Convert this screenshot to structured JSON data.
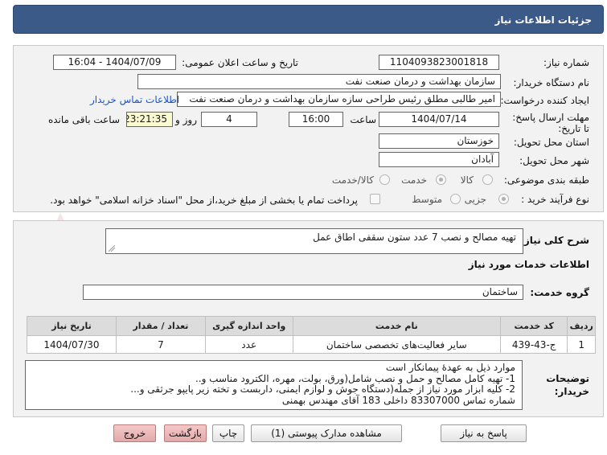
{
  "header": {
    "title": "جزئیات اطلاعات نیاز"
  },
  "fields": {
    "need_number_label": "شماره نیاز:",
    "need_number": "1104093823001818",
    "announce_label": "تاریخ و ساعت اعلان عمومی:",
    "announce_value": "1404/07/09 - 16:04",
    "buyer_org_label": "نام دستگاه خریدار:",
    "buyer_org": "سازمان بهداشت و درمان صنعت نفت",
    "creator_label": "ایجاد کننده درخواست:",
    "creator": "امیر طالبی مطلق رئیس طراحی سازه سازمان بهداشت و درمان صنعت نفت",
    "contact_link": "اطلاعات تماس خریدار",
    "deadline_label": "مهلت ارسال پاسخ: تا تاریخ:",
    "deadline_date": "1404/07/14",
    "time_label": "ساعت",
    "deadline_time": "16:00",
    "days_value": "4",
    "days_label": "روز و",
    "remaining_time": "23:21:35",
    "remaining_label": "ساعت باقی مانده",
    "province_label": "استان محل تحویل:",
    "province": "خوزستان",
    "city_label": "شهر محل تحویل:",
    "city": "آبادان",
    "category_label": "طبقه بندی موضوعی:",
    "category_options": [
      "کالا",
      "خدمت",
      "کالا/خدمت"
    ],
    "process_label": "نوع فرآیند خرید :",
    "process_options": [
      "جزیی",
      "متوسط"
    ],
    "payment_note": "پرداخت تمام یا بخشی از مبلغ خرید،از محل \"اسناد خزانه اسلامی\" خواهد بود."
  },
  "need_summary": {
    "label": "شرح کلی نیاز:",
    "value": "تهیه مصالح و نصب 7 عدد ستون سقفی اطاق عمل"
  },
  "services": {
    "section_title": "اطلاعات خدمات مورد نیاز",
    "group_label": "گروه خدمت:",
    "group_value": "ساختمان",
    "columns": [
      "ردیف",
      "کد خدمت",
      "نام خدمت",
      "واحد اندازه گیری",
      "تعداد / مقدار",
      "تاریخ نیاز"
    ],
    "rows": [
      [
        "1",
        "ج-43-439",
        "سایر فعالیت‌های تخصصی ساختمان",
        "عدد",
        "7",
        "1404/07/30"
      ]
    ]
  },
  "buyer_notes": {
    "label": "توضیحات خریدار:",
    "lines": [
      "موارد ذیل به عهدهٔ پیمانکار است",
      "1- تهیه کامل مصالح و حمل و نصب شامل(ورق، بولت، مهره،  الکترود مناسب و..",
      "2- کلیه ابزار مورد نیاز از جمله(دستگاه جوش و لوازم ایمنی، داربست و تخته زیر پایپو جرثقی و...",
      "شماره تماس 83307000 داخلی 183 آقای مهندس بهمنی"
    ]
  },
  "buttons": {
    "reply": "پاسخ به نیاز",
    "attachments": "مشاهده مدارک پیوستی (1)",
    "print": "چاپ",
    "back": "بازگشت",
    "exit": "خروج"
  },
  "watermark": {
    "text": "AriaTender.net"
  }
}
